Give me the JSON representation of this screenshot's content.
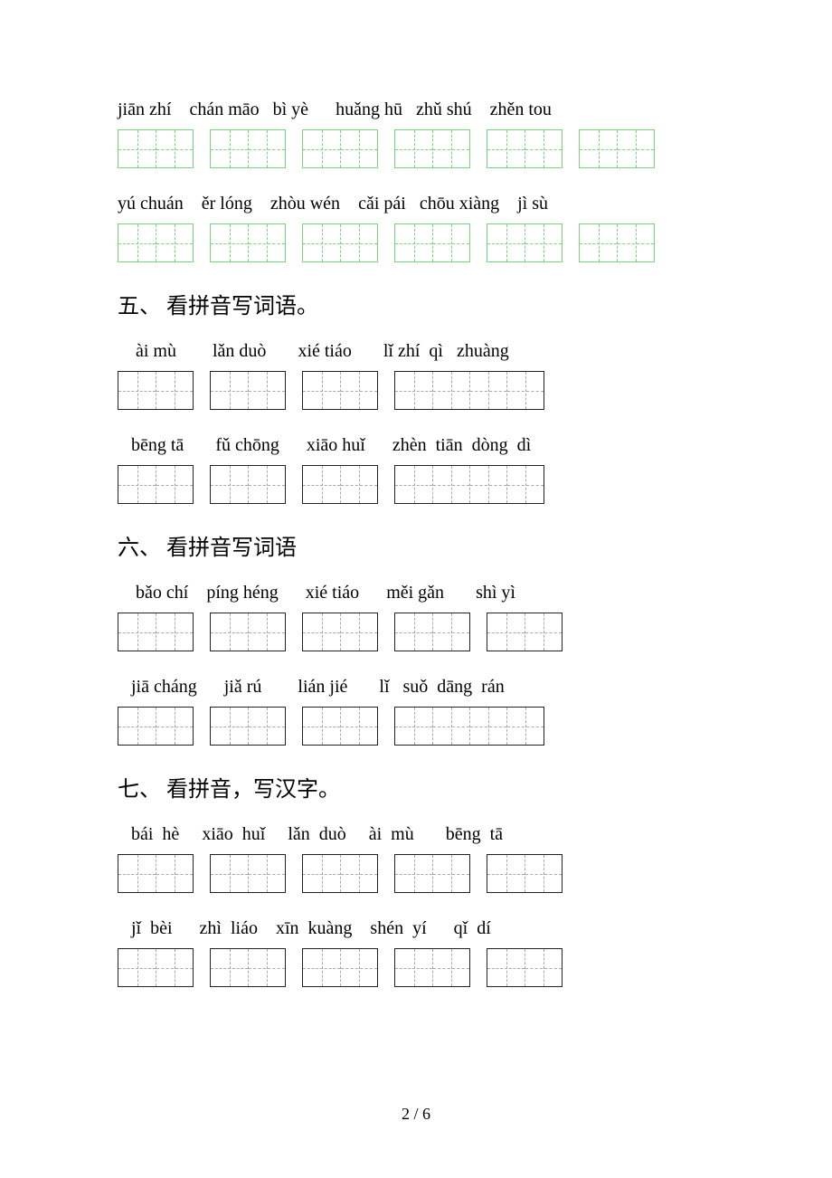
{
  "topRows": [
    {
      "pinyin": [
        "jiān zhí",
        "chán māo",
        "bì yè",
        "huǎng hū",
        "zhǔ shú",
        "zhěn tou"
      ],
      "gaps": [
        "    ",
        "   ",
        "      ",
        "   ",
        "    ",
        ""
      ],
      "boxes": [
        2,
        2,
        2,
        2,
        2,
        2
      ],
      "style": "green"
    },
    {
      "pinyin": [
        "yú chuán",
        "ěr lóng",
        "zhòu wén",
        "cǎi pái",
        "chōu xiàng",
        "jì sù"
      ],
      "gaps": [
        "    ",
        "    ",
        "    ",
        "   ",
        "    ",
        ""
      ],
      "boxes": [
        2,
        2,
        2,
        2,
        2,
        2
      ],
      "style": "green"
    }
  ],
  "sections": [
    {
      "title": "五、 看拼音写词语。",
      "rows": [
        {
          "pinyin": [
            "ài mù",
            "lǎn duò",
            "xié tiáo",
            "lǐ zhí  qì   zhuàng"
          ],
          "gaps": [
            "        ",
            "       ",
            "       ",
            ""
          ],
          "prefix": "    ",
          "boxes": [
            2,
            2,
            2,
            4
          ],
          "style": "black"
        },
        {
          "pinyin": [
            "bēng tā",
            "fǔ chōng",
            "xiāo huǐ",
            "zhèn  tiān  dòng  dì"
          ],
          "gaps": [
            "       ",
            "      ",
            "      ",
            ""
          ],
          "prefix": "   ",
          "boxes": [
            2,
            2,
            2,
            4
          ],
          "style": "black"
        }
      ]
    },
    {
      "title": "六、 看拼音写词语",
      "rows": [
        {
          "pinyin": [
            "bǎo chí",
            "píng héng",
            "xié tiáo",
            "měi gǎn",
            "shì yì"
          ],
          "gaps": [
            "    ",
            "      ",
            "      ",
            "       ",
            ""
          ],
          "prefix": "    ",
          "boxes": [
            2,
            2,
            2,
            2,
            2
          ],
          "style": "black"
        },
        {
          "pinyin": [
            "jiā cháng",
            "jiǎ rú",
            "lián jié",
            "lǐ   suǒ  dāng  rán"
          ],
          "gaps": [
            "      ",
            "        ",
            "       ",
            ""
          ],
          "prefix": "   ",
          "boxes": [
            2,
            2,
            2,
            4
          ],
          "style": "black"
        }
      ]
    },
    {
      "title": "七、 看拼音，写汉字。",
      "rows": [
        {
          "pinyin": [
            "bái  hè",
            "xiāo  huǐ",
            "lǎn  duò",
            "ài  mù",
            "bēng  tā"
          ],
          "gaps": [
            "     ",
            "     ",
            "     ",
            "       ",
            ""
          ],
          "prefix": "   ",
          "boxes": [
            2,
            2,
            2,
            2,
            2
          ],
          "style": "black"
        },
        {
          "pinyin": [
            "jǐ  bèi",
            "zhì  liáo",
            "xīn  kuàng",
            "shén  yí",
            "qǐ  dí"
          ],
          "gaps": [
            "      ",
            "    ",
            "    ",
            "      ",
            ""
          ],
          "prefix": "   ",
          "boxes": [
            2,
            2,
            2,
            2,
            2
          ],
          "style": "black"
        }
      ]
    }
  ],
  "footer": "2 / 6"
}
